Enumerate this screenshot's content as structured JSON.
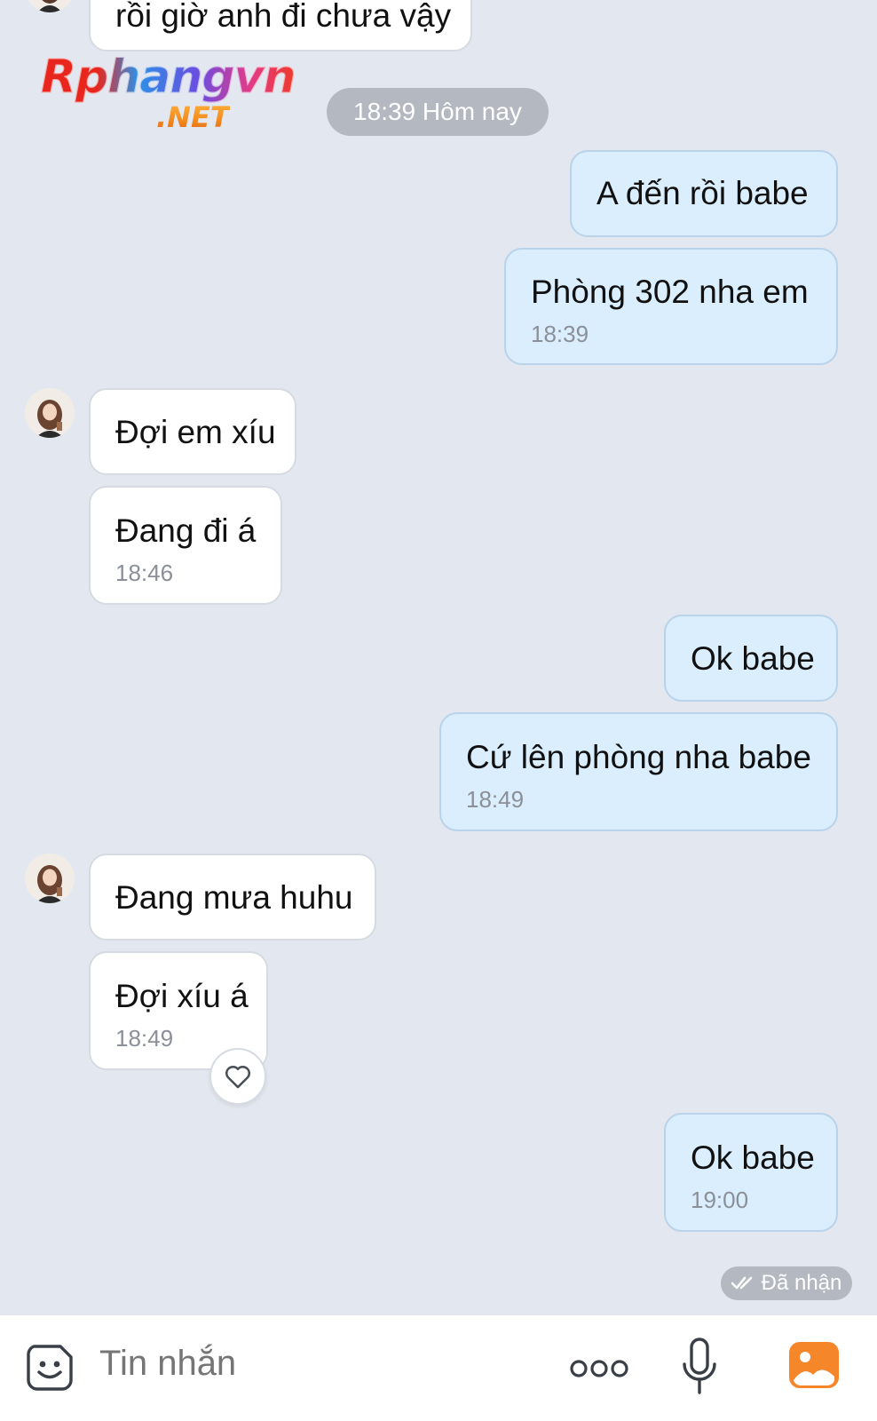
{
  "conversation": {
    "partial_top_message": "rồi giờ anh đi chưa vậy",
    "time_separator": "18:39 Hôm nay",
    "messages": [
      {
        "from": "me",
        "text": "A đến rồi babe",
        "time": ""
      },
      {
        "from": "me",
        "text": "Phòng 302 nha em",
        "time": "18:39"
      },
      {
        "from": "them",
        "text": "Đợi em xíu",
        "time": ""
      },
      {
        "from": "them",
        "text": "Đang đi á",
        "time": "18:46"
      },
      {
        "from": "me",
        "text": "Ok babe",
        "time": ""
      },
      {
        "from": "me",
        "text": "Cứ lên phòng nha babe",
        "time": "18:49"
      },
      {
        "from": "them",
        "text": "Đang mưa huhu",
        "time": ""
      },
      {
        "from": "them",
        "text": "Đợi xíu á",
        "time": "18:49"
      },
      {
        "from": "me",
        "text": "Ok babe",
        "time": "19:00"
      }
    ],
    "delivery_status": "Đã nhận",
    "reaction_icon": "heart-outline-icon"
  },
  "watermark": {
    "main": "Rphangvn",
    "suffix": ".NET"
  },
  "input_bar": {
    "placeholder": "Tin nhắn",
    "icons": [
      "sticker-icon",
      "more-icon",
      "microphone-icon",
      "image-gallery-icon"
    ],
    "accent_color": "#f6862a"
  }
}
